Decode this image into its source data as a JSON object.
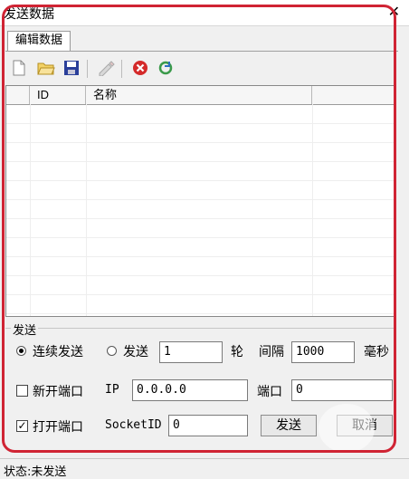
{
  "window": {
    "title": "发送数据"
  },
  "tabs": [
    {
      "label": "编辑数据"
    }
  ],
  "toolbar": {
    "icons": [
      "new-file-icon",
      "open-folder-icon",
      "save-icon",
      "edit-icon",
      "delete-icon",
      "refresh-icon"
    ]
  },
  "table": {
    "columns": [
      "",
      "ID",
      "名称",
      ""
    ],
    "rows": []
  },
  "send_group": {
    "label": "发送",
    "continuous_label": "连续发送",
    "send_label": "发送",
    "rounds_value": "1",
    "rounds_unit": "轮",
    "interval_label": "间隔",
    "interval_value": "1000",
    "interval_unit": "毫秒",
    "mode_selected": "连续发送",
    "new_port": {
      "label": "新开端口",
      "checked": false,
      "ip_label": "IP",
      "ip_value": "0.0.0.0",
      "port_label": "端口",
      "port_value": "0"
    },
    "open_port": {
      "label": "打开端口",
      "checked": true,
      "socket_label": "SocketID",
      "socket_value": "0"
    },
    "send_button": "发送",
    "cancel_button": "取消"
  },
  "status": {
    "text": "状态:未发送"
  },
  "colors": {
    "highlight_frame": "#d02434",
    "delete_red": "#d42a2a",
    "save_blue": "#2a3f9a"
  }
}
